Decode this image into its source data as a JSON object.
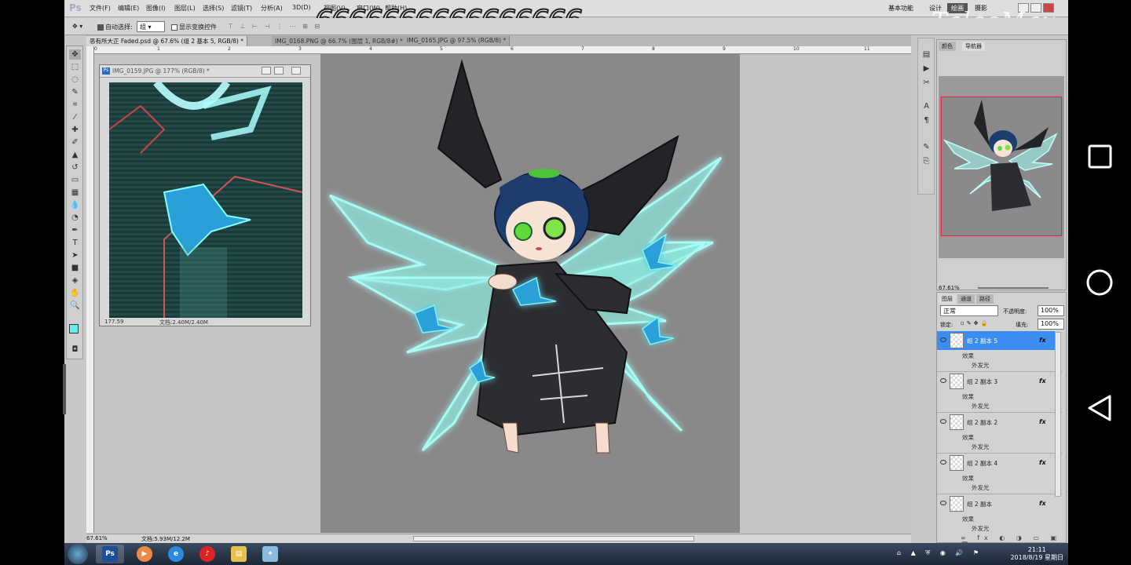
{
  "overlay": {
    "text": "6666666666666666",
    "watermark": "TalesMax"
  },
  "menubar": {
    "app_logo": "Ps",
    "items": [
      "文件(F)",
      "编辑(E)",
      "图像(I)",
      "图层(L)",
      "选择(S)",
      "滤镜(T)",
      "分析(A)",
      "3D(D)",
      "视图(V)",
      "窗口(W)",
      "帮助(H)"
    ],
    "workspaces": [
      "基本功能",
      "设计",
      "绘画",
      "摄影"
    ]
  },
  "options": {
    "auto_select_label": "自动选择:",
    "auto_select_value": "组",
    "show_transform_label": "显示变换控件"
  },
  "tabs": [
    "恶有所大正 Faded.psd @ 67.6% (组 2 基本 5, RGB/8) *",
    "IMG_0168.PNG @ 66.7% (图层 1, RGB/8#) *",
    "IMG_0165.JPG @ 97.5% (RGB/8) *"
  ],
  "ruler": {
    "ticks": [
      "0",
      "1",
      "2",
      "3",
      "4",
      "5",
      "6",
      "7",
      "8",
      "9",
      "10",
      "11"
    ]
  },
  "docwin": {
    "title": "IMG_0159.JPG @ 177% (RGB/8) *",
    "zoom": "177.59",
    "doc_size": "文档:2.40M/2.40M"
  },
  "statusbar": {
    "zoom": "67.61%",
    "doc_size": "文档:5.93M/12.2M"
  },
  "navigator": {
    "tabs": [
      "颜色",
      "导航器"
    ],
    "zoom": "67.61%"
  },
  "layers": {
    "tabs": [
      "图层",
      "通道",
      "路径"
    ],
    "blend_mode": "正常",
    "opacity_label": "不透明度:",
    "opacity": "100%",
    "lock_label": "锁定:",
    "fill_label": "填充:",
    "fill": "100%",
    "items": [
      {
        "name": "组 2 副本 5",
        "effects": "效果",
        "effect": "外发光"
      },
      {
        "name": "组 2 副本 3",
        "effects": "效果",
        "effect": "外发光"
      },
      {
        "name": "组 2 副本 2",
        "effects": "效果",
        "effect": "外发光"
      },
      {
        "name": "组 2 副本 4",
        "effects": "效果",
        "effect": "外发光"
      },
      {
        "name": "组 2 副本",
        "effects": "效果",
        "effect": "外发光"
      }
    ]
  },
  "taskbar": {
    "time": "21:11",
    "date": "2018/8/19 星期日"
  },
  "colors": {
    "accent": "#3b8ef0",
    "foreground_color": "#5ff0e8",
    "wing_glow": "#7ff6f0",
    "selected_layer": "#3b8ef0"
  },
  "icons": [
    "move-icon",
    "marquee-icon",
    "lasso-icon",
    "eye-icon",
    "fx-icon",
    "square-nav-icon",
    "circle-nav-icon",
    "triangle-nav-icon",
    "windows-start-icon"
  ]
}
